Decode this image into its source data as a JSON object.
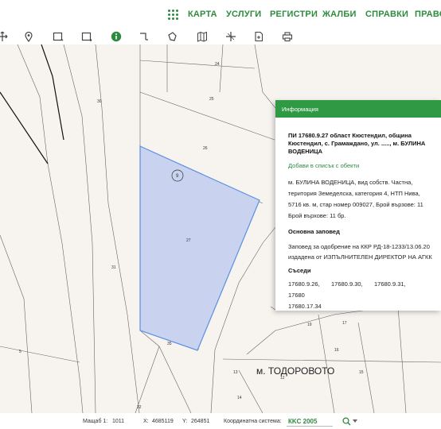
{
  "nav": {
    "items": [
      "КАРТА",
      "УСЛУГИ",
      "РЕГИСТРИ",
      "ЖАЛБИ",
      "СПРАВКИ",
      "ПРАВО"
    ]
  },
  "toolbar": {
    "icons": [
      "move-icon",
      "location-pin-icon",
      "select-rectangle-icon",
      "select-area-icon",
      "info-icon",
      "measure-line-icon",
      "measure-area-icon",
      "map-icon",
      "coordinates-icon",
      "export-icon",
      "print-icon"
    ]
  },
  "map": {
    "parcels": [
      "24",
      "25",
      "26",
      "27",
      "30",
      "31",
      "35",
      "32",
      "5",
      "13",
      "9",
      "19",
      "17",
      "14",
      "16",
      "15",
      "12"
    ],
    "selected_marker": "9",
    "place_label": "м. ТОДОРОВОТО",
    "selected_fill": "#c9d3ef",
    "selected_stroke": "#5a8fe0"
  },
  "info": {
    "header": "Информация",
    "title": "ПИ 17680.9.27 област Кюстендил, община Кюстендил, с. Грамаждано, ул. ....., м. БУЛИНА ВОДЕНИЦА",
    "add_link": "Добави в списък с обекти",
    "description": "м. БУЛИНА ВОДЕНИЦА, вид собств. Частна,\nтеритория Земеделска, категория 4, НТП Нива,\n5716 кв. м, стар номер 009027, Брой вързове: 11\nБрой върхове: 11 бр.",
    "order_heading": "Основна заповед",
    "order_text": "Заповед за одобрение на ККР РД-18-1233/13.06.20\nиздадена от ИЗПЪЛНИТЕЛЕН ДИРЕКТОР НА АГКК",
    "neighbors_heading": "Съседи",
    "neighbors": [
      "17680.9.26,",
      "17680.9.30,",
      "17680.9.31,",
      "17680",
      "17680.17.34"
    ]
  },
  "status": {
    "scale_label": "Мащаб 1:",
    "scale_value": "1011",
    "x_label": "X:",
    "x_value": "4685119",
    "y_label": "Y:",
    "y_value": "264851",
    "system_label": "Координатна система:",
    "system_value": "КKC 2005"
  },
  "colors": {
    "accent": "#2e8b3e",
    "panel_header": "#2f9a43"
  }
}
